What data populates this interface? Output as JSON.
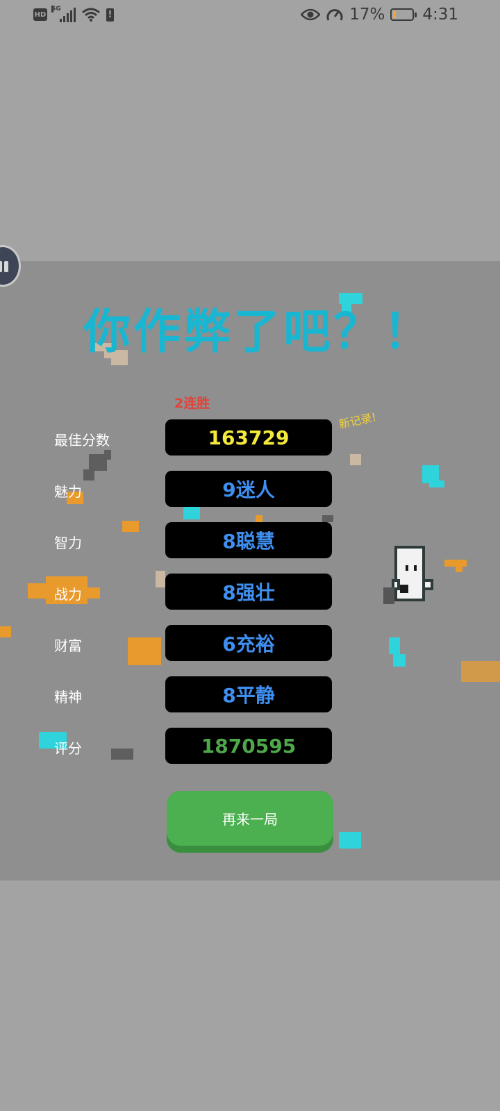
{
  "status_bar": {
    "hd": "HD",
    "network": "5G",
    "battery_percent": "17%",
    "battery_level": 0.17,
    "time": "4:31"
  },
  "game": {
    "title": "你作弊了吧？！",
    "streak": "2连胜",
    "new_record": "新记录!",
    "stats": [
      {
        "label": "最佳分数",
        "value": "163729",
        "color": "#f4ea3c"
      },
      {
        "label": "魅力",
        "value": "9迷人",
        "color": "#3f8ff0"
      },
      {
        "label": "智力",
        "value": "8聪慧",
        "color": "#3f8ff0"
      },
      {
        "label": "战力",
        "value": "8强壮",
        "color": "#3f8ff0"
      },
      {
        "label": "财富",
        "value": "6充裕",
        "color": "#3f8ff0"
      },
      {
        "label": "精神",
        "value": "8平静",
        "color": "#3f8ff0"
      },
      {
        "label": "评分",
        "value": "1870595",
        "color": "#4ea84a"
      }
    ],
    "play_again": "再来一局"
  },
  "colors": {
    "title": "#19b6d2",
    "button": "#4caf50",
    "panel": "#8f8f8f",
    "background": "#a3a3a3"
  }
}
